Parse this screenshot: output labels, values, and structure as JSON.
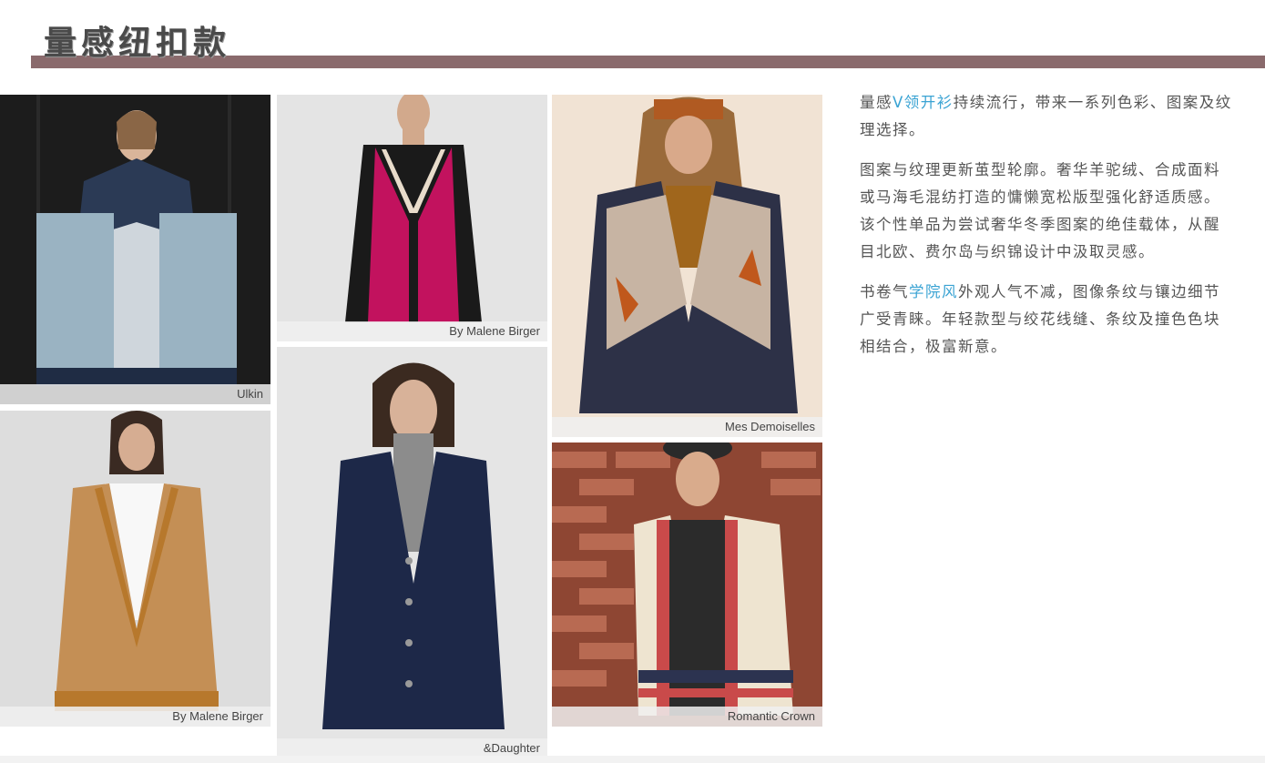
{
  "page": {
    "title": "量感纽扣款",
    "colors": {
      "title_bar": "#8a6a6c",
      "highlight": "#3aa3d3",
      "text": "#555555"
    }
  },
  "photos": [
    {
      "caption": "Ulkin"
    },
    {
      "caption": "By Malene Birger"
    },
    {
      "caption": "By Malene Birger"
    },
    {
      "caption": "&Daughter"
    },
    {
      "caption": "Mes Demoiselles"
    },
    {
      "caption": "Romantic Crown"
    }
  ],
  "text": {
    "p1_a": "量感",
    "p1_hl": "V领开衫",
    "p1_b": "持续流行，带来一系列色彩、图案及纹理选择。",
    "p2": "图案与纹理更新茧型轮廓。奢华羊驼绒、合成面料或马海毛混纺打造的慵懒宽松版型强化舒适质感。该个性单品为尝试奢华冬季图案的绝佳载体，从醒目北欧、费尔岛与织锦设计中汲取灵感。",
    "p3_a": "书卷气",
    "p3_hl": "学院风",
    "p3_b": "外观人气不减，图像条纹与镶边细节广受青睐。年轻款型与绞花线缝、条纹及撞色色块相结合，极富新意。"
  }
}
